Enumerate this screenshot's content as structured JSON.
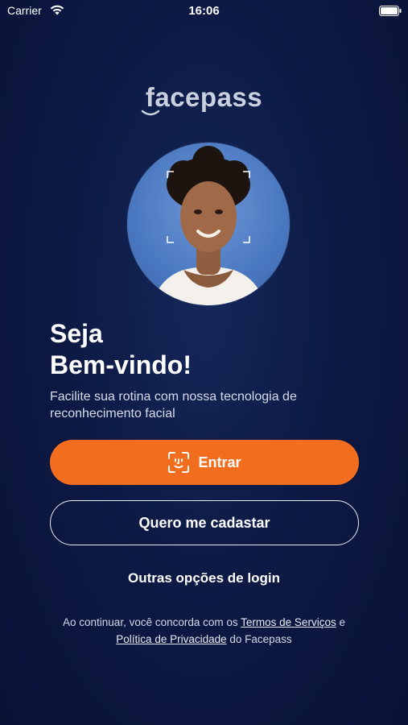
{
  "status_bar": {
    "carrier": "Carrier",
    "time": "16:06"
  },
  "logo": {
    "text": "facepass"
  },
  "welcome": {
    "line1": "Seja",
    "line2": "Bem-vindo!"
  },
  "subtitle": "Facilite sua rotina com nossa tecnologia de reconhecimento facial",
  "buttons": {
    "primary_label": "Entrar",
    "secondary_label": "Quero me cadastar",
    "other_login": "Outras opções de login"
  },
  "terms": {
    "prefix": "Ao continuar, você concorda com os",
    "link1": "Termos de Serviços",
    "conjunction": "e",
    "link2": "Política de Privacidade",
    "suffix": "do Facepass"
  },
  "colors": {
    "accent": "#f26d1d",
    "background": "#0d1a45",
    "text": "#ffffff"
  }
}
